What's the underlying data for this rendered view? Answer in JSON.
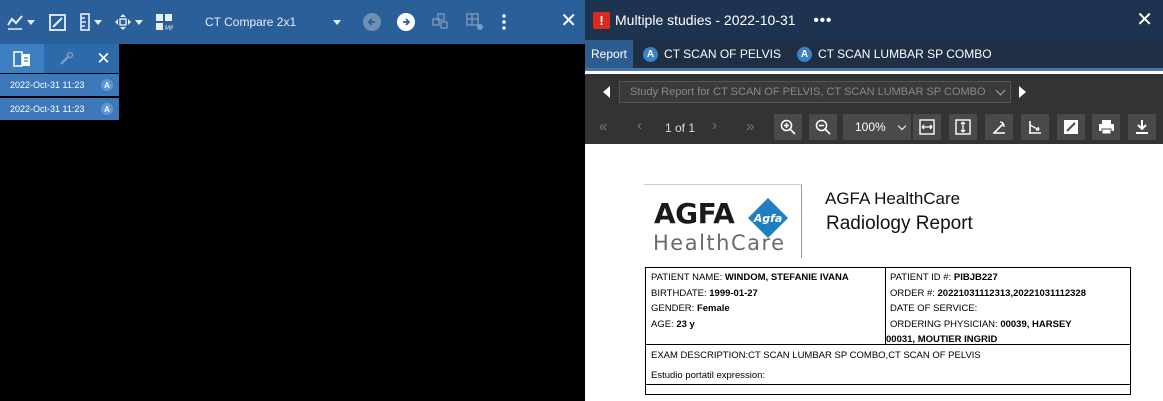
{
  "left_toolbar": {
    "layout_label": "CT Compare 2x1",
    "icons": [
      "tools-icon",
      "annotate-icon",
      "ruler-icon",
      "navigate-icon",
      "mpr-icon"
    ]
  },
  "study_list": {
    "header_icons": [
      "compare-icon",
      "edit-icon",
      "close-icon"
    ],
    "rows": [
      {
        "date": "2022-Oct-31 11:23",
        "badge": "A"
      },
      {
        "date": "2022-Oct-31 11:23",
        "badge": "A"
      }
    ]
  },
  "report_window": {
    "title": "Multiple studies - 2022-10-31",
    "alert_glyph": "!",
    "more_glyph": "•••",
    "tabs": [
      {
        "label": "Report",
        "badge": ""
      },
      {
        "label": "CT SCAN OF PELVIS",
        "badge": "A"
      },
      {
        "label": "CT SCAN LUMBAR SP COMBO",
        "badge": "A"
      }
    ],
    "study_select": "Study Report for CT SCAN OF PELVIS, CT SCAN LUMBAR SP COMBO",
    "page_of": "1 of 1",
    "zoom": "100%"
  },
  "document": {
    "logo": {
      "word": "AGFA",
      "diamond_text": "Agfa",
      "sub": "HealthCare"
    },
    "company": "AGFA HealthCare",
    "report_title": "Radiology Report",
    "patient_name_label": "PATIENT NAME:",
    "patient_name": "WINDOM, STEFANIE IVANA",
    "birthdate_label": "BIRTHDATE:",
    "birthdate": "1999-01-27",
    "gender_label": "GENDER:",
    "gender": "Female",
    "age_label": "AGE:",
    "age": "23 y",
    "patient_id_label": "PATIENT ID #:",
    "patient_id": "PIBJB227",
    "order_label": "ORDER #:",
    "order": "20221031112313,20221031112328",
    "date_of_service_label": "DATE OF SERVICE:",
    "ordering_physician_label": "ORDERING PHYSICIAN:",
    "ordering_physician_1": "00039, HARSEY",
    "ordering_physician_2": "00031, MOUTIER INGRID",
    "exam_label": "EXAM DESCRIPTION:",
    "exam": "CT SCAN LUMBAR SP COMBO,CT SCAN OF PELVIS",
    "note": "Estudio portatil expression:"
  },
  "colors": {
    "toolbar_blue": "#2b5f9a",
    "title_bar": "#1e3350",
    "alert_red": "#d92b1e",
    "doc_toolbar": "#333333"
  }
}
